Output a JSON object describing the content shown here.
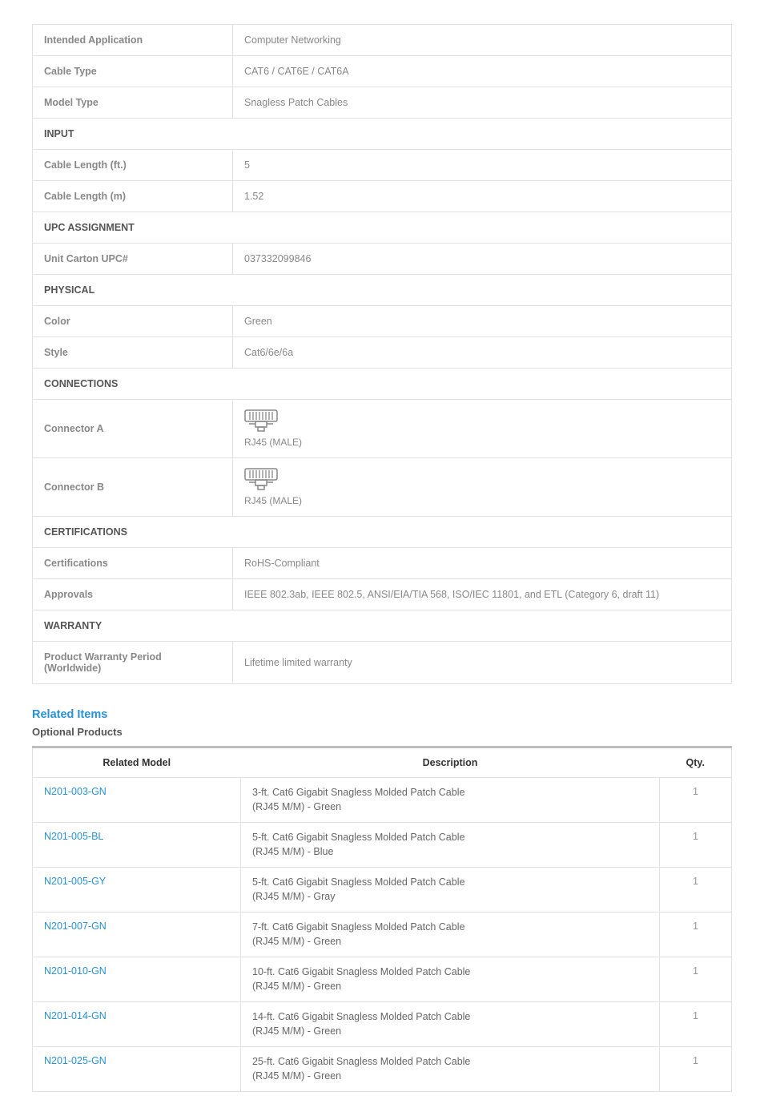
{
  "spec": {
    "rows": [
      {
        "type": "kv",
        "label": "Intended Application",
        "value": "Computer Networking"
      },
      {
        "type": "kv",
        "label": "Cable Type",
        "value": "CAT6 / CAT6E / CAT6A"
      },
      {
        "type": "kv",
        "label": "Model Type",
        "value": "Snagless Patch Cables"
      },
      {
        "type": "section",
        "label": "INPUT"
      },
      {
        "type": "kv",
        "label": "Cable Length (ft.)",
        "value": "5"
      },
      {
        "type": "kv",
        "label": "Cable Length (m)",
        "value": "1.52"
      },
      {
        "type": "section",
        "label": "UPC ASSIGNMENT"
      },
      {
        "type": "kv",
        "label": "Unit Carton UPC#",
        "value": "037332099846"
      },
      {
        "type": "section",
        "label": "PHYSICAL"
      },
      {
        "type": "kv",
        "label": "Color",
        "value": "Green"
      },
      {
        "type": "kv",
        "label": "Style",
        "value": "Cat6/6e/6a"
      },
      {
        "type": "section",
        "label": "CONNECTIONS"
      },
      {
        "type": "connector",
        "label": "Connector A",
        "value": "RJ45 (MALE)"
      },
      {
        "type": "connector",
        "label": "Connector B",
        "value": "RJ45 (MALE)"
      },
      {
        "type": "section",
        "label": "CERTIFICATIONS"
      },
      {
        "type": "kv",
        "label": "Certifications",
        "value": "RoHS-Compliant"
      },
      {
        "type": "kv",
        "label": "Approvals",
        "value": "IEEE 802.3ab, IEEE 802.5, ANSI/EIA/TIA 568, ISO/IEC 11801, and ETL (Category 6, draft 11)"
      },
      {
        "type": "section",
        "label": "WARRANTY"
      },
      {
        "type": "kv",
        "label": "Product Warranty Period (Worldwide)",
        "value": "Lifetime limited warranty"
      }
    ]
  },
  "related": {
    "heading": "Related Items",
    "subheading": "Optional Products",
    "columns": {
      "model": "Related Model",
      "desc": "Description",
      "qty": "Qty."
    },
    "items": [
      {
        "model": "N201-003-GN",
        "desc": "3-ft. Cat6 Gigabit Snagless Molded Patch Cable\n(RJ45 M/M) - Green",
        "qty": "1"
      },
      {
        "model": "N201-005-BL",
        "desc": "5-ft. Cat6 Gigabit Snagless Molded Patch Cable\n(RJ45 M/M) - Blue",
        "qty": "1"
      },
      {
        "model": "N201-005-GY",
        "desc": "5-ft. Cat6 Gigabit Snagless Molded Patch Cable\n(RJ45 M/M) - Gray",
        "qty": "1"
      },
      {
        "model": "N201-007-GN",
        "desc": "7-ft. Cat6 Gigabit Snagless Molded Patch Cable\n(RJ45 M/M) - Green",
        "qty": "1"
      },
      {
        "model": "N201-010-GN",
        "desc": "10-ft. Cat6 Gigabit Snagless Molded Patch Cable\n(RJ45 M/M) - Green",
        "qty": "1"
      },
      {
        "model": "N201-014-GN",
        "desc": "14-ft. Cat6 Gigabit Snagless Molded Patch Cable\n(RJ45 M/M) - Green",
        "qty": "1"
      },
      {
        "model": "N201-025-GN",
        "desc": "25-ft. Cat6 Gigabit Snagless Molded Patch Cable\n(RJ45 M/M) - Green",
        "qty": "1"
      }
    ]
  }
}
